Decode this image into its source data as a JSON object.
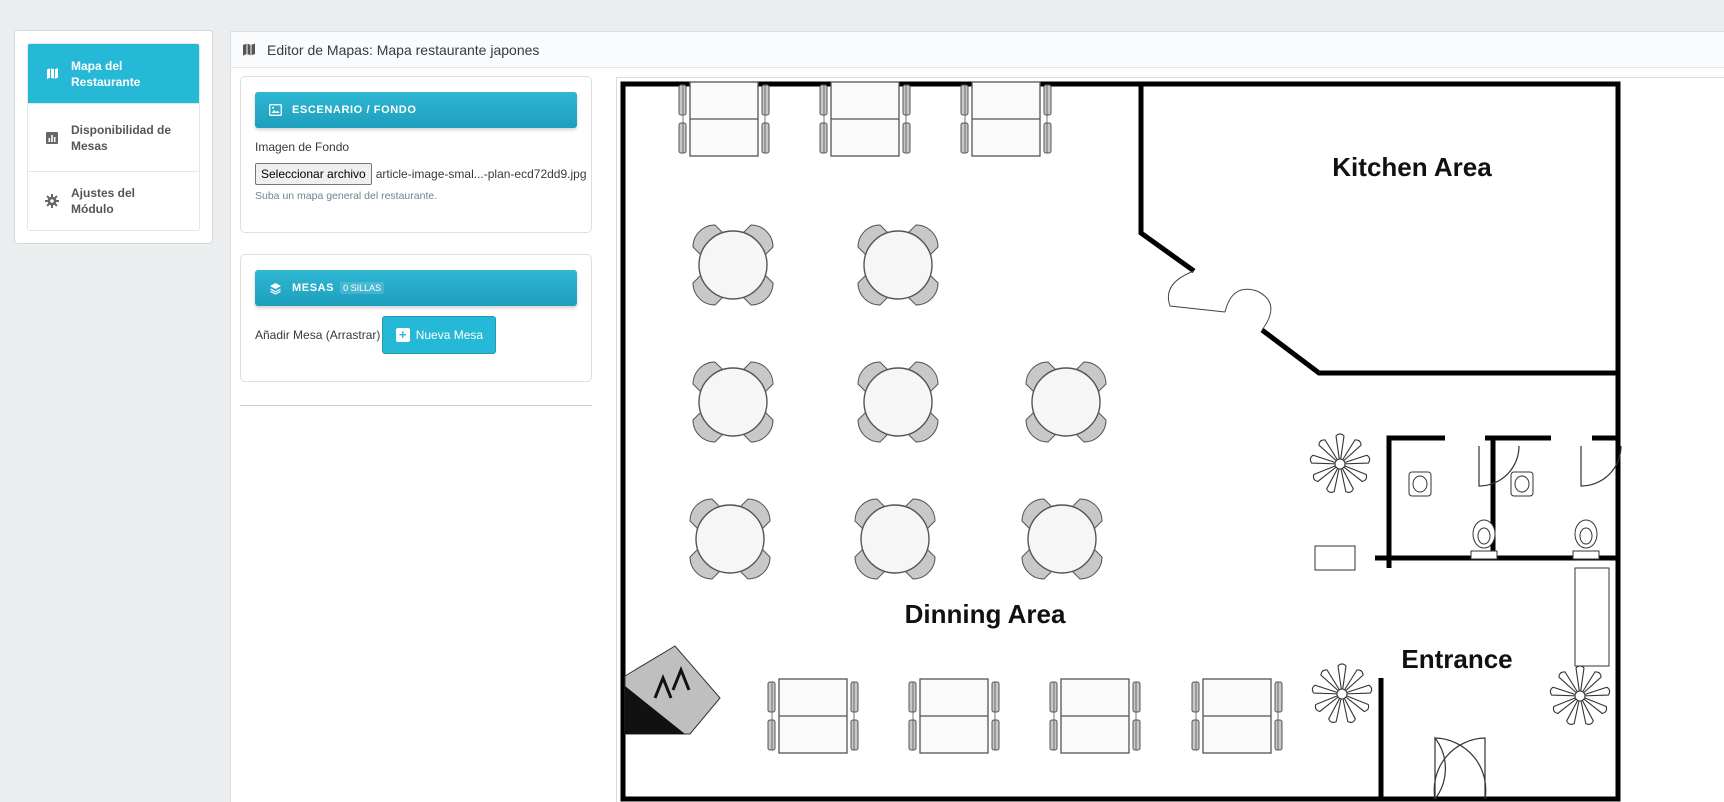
{
  "sidebar": {
    "items": [
      {
        "label": "Mapa del Restaurante",
        "icon": "map-icon",
        "active": true
      },
      {
        "label": "Disponibilidad de Mesas",
        "icon": "bar-chart-icon",
        "active": false
      },
      {
        "label": "Ajustes del Módulo",
        "icon": "gear-icon",
        "active": false
      }
    ]
  },
  "header": {
    "title": "Editor de Mapas: Mapa restaurante japones",
    "icon": "map-icon"
  },
  "escenario": {
    "title": "ESCENARIO / FONDO",
    "icon": "image-icon",
    "field_label": "Imagen de Fondo",
    "file_button": "Seleccionar archivo",
    "file_name": "article-image-smal...-plan-ecd72dd9.jpg",
    "help": "Suba un mapa general del restaurante."
  },
  "mesas": {
    "title": "MESAS",
    "badge": "0 SILLAS",
    "icon": "layers-icon",
    "add_label": "Añadir Mesa (Arrastrar)",
    "add_button": "Nueva Mesa"
  },
  "floorplan": {
    "areas": [
      "Kitchen Area",
      "Dinning Area",
      "Entrance"
    ]
  },
  "colors": {
    "accent": "#25b9d7",
    "header_gradient_top": "#2fb7d3",
    "header_gradient_bottom": "#1d9fbd"
  }
}
